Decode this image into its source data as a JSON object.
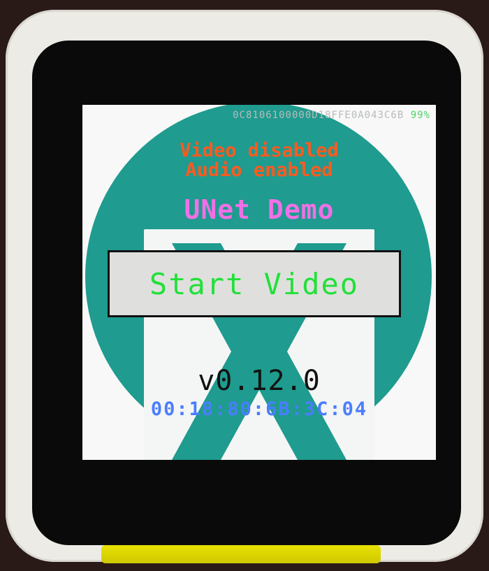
{
  "device": {
    "id": "0C8106100000D18FFE0A043C6B",
    "battery": "99%"
  },
  "status": {
    "video": "Video disabled",
    "audio": "Audio enabled"
  },
  "app": {
    "title": "UNet Demo",
    "start_label": "Start Video",
    "version": "v0.12.0",
    "mac": "00:18:80:6B:3C:04"
  },
  "colors": {
    "logo_circle": "#1f9b8f",
    "status_text": "#ff5a1f",
    "title_text": "#f070e6",
    "button_text": "#22e03a",
    "mac_text": "#4b7dff",
    "battery_text": "#4fd46a"
  },
  "icons": {
    "background_logo": "uxn-logo-icon"
  }
}
